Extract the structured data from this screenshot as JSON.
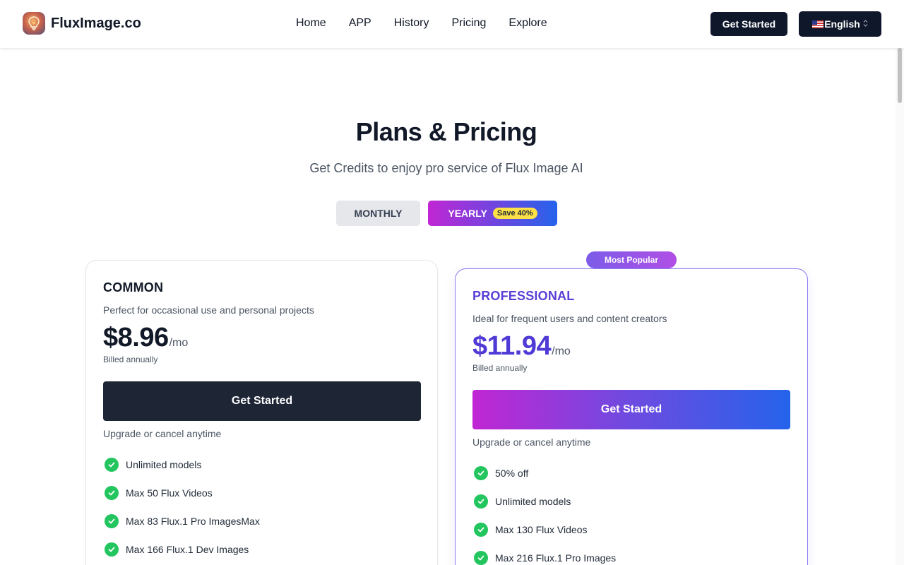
{
  "header": {
    "logo_text": "FluxImage.co",
    "nav": [
      "Home",
      "APP",
      "History",
      "Pricing",
      "Explore"
    ],
    "get_started": "Get Started",
    "language": "English"
  },
  "hero": {
    "title": "Plans & Pricing",
    "subtitle": "Get Credits to enjoy pro service of Flux Image AI"
  },
  "toggle": {
    "monthly": "MONTHLY",
    "yearly": "YEARLY",
    "save": "Save 40%",
    "selected": "YEARLY"
  },
  "plans": [
    {
      "name": "COMMON",
      "description": "Perfect for occasional use and personal projects",
      "price": "$8.96",
      "per": "/mo",
      "billed": "Billed annually",
      "cta": "Get Started",
      "note": "Upgrade or cancel anytime",
      "features": [
        "Unlimited models",
        "Max 50 Flux Videos",
        "Max 83 Flux.1 Pro ImagesMax",
        "Max 166 Flux.1 Dev Images"
      ]
    },
    {
      "name": "PROFESSIONAL",
      "badge": "Most Popular",
      "description": "Ideal for frequent users and content creators",
      "price": "$11.94",
      "per": "/mo",
      "billed": "Billed annually",
      "cta": "Get Started",
      "note": "Upgrade or cancel anytime",
      "features": [
        "50% off",
        "Unlimited models",
        "Max 130 Flux Videos",
        "Max 216 Flux.1 Pro Images"
      ]
    }
  ],
  "colors": {
    "primary_dark": "#0f172a",
    "accent_purple": "#5b3fd6",
    "gradient_start": "#c026d3",
    "gradient_end": "#2563eb",
    "check_green": "#22c55e",
    "badge_yellow": "#fde047"
  },
  "icons": {
    "logo": "lightbulb-icon",
    "check": "check-circle-icon",
    "flag": "us-flag-icon",
    "select": "chevron-updown-icon"
  }
}
